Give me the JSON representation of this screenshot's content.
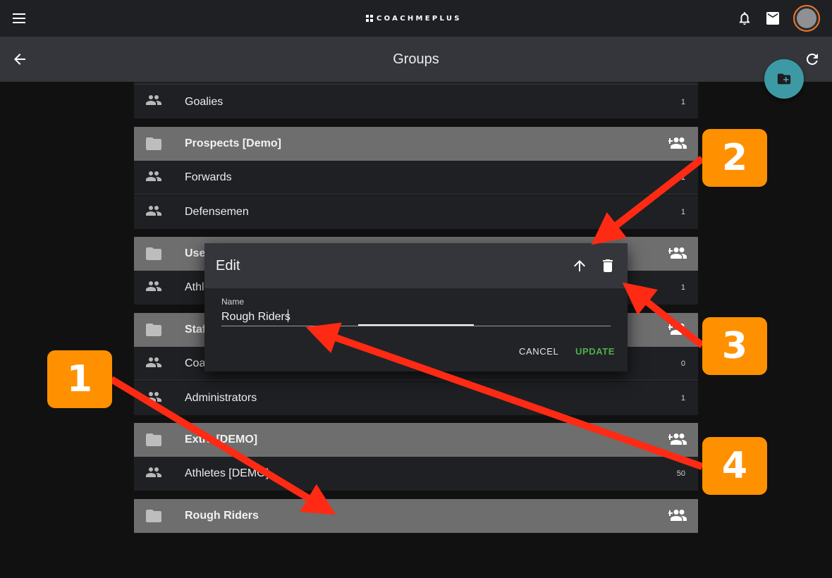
{
  "app": {
    "brand": "COACHMEPLUS",
    "page_title": "Groups"
  },
  "colors": {
    "fab": "#3d9aa5",
    "avatar_ring": "#f07a2b",
    "update_button": "#4caf50",
    "annotation_badge": "#ff9100",
    "annotation_arrow": "#ff2a14"
  },
  "icons": {
    "menu": "menu-icon",
    "notifications": "bell-icon",
    "messages": "mail-icon",
    "back": "arrow-back-icon",
    "refresh": "refresh-icon",
    "add_folder": "create-new-folder-icon",
    "folder": "folder-icon",
    "group": "group-icon",
    "add_group": "group-add-icon",
    "move_up": "arrow-up-icon",
    "delete": "trash-icon"
  },
  "groups": [
    {
      "type": "subgroup",
      "label": "Goalies",
      "count": "1"
    },
    {
      "type": "header",
      "label": "Prospects [Demo]"
    },
    {
      "type": "subgroup",
      "label": "Forwards",
      "count": "1"
    },
    {
      "type": "subgroup",
      "label": "Defensemen",
      "count": "1"
    },
    {
      "type": "header",
      "label": "Use"
    },
    {
      "type": "subgroup",
      "label": "Athl",
      "count": "1"
    },
    {
      "type": "header",
      "label": "Staf"
    },
    {
      "type": "subgroup",
      "label": "Coa",
      "count": "0"
    },
    {
      "type": "subgroup",
      "label": "Administrators",
      "count": "1"
    },
    {
      "type": "header",
      "label": "Extra [DEMO]"
    },
    {
      "type": "subgroup",
      "label": "Athletes [DEMO]",
      "count": "50"
    },
    {
      "type": "header",
      "label": "Rough Riders"
    }
  ],
  "dialog": {
    "title": "Edit",
    "field_label": "Name",
    "field_value": "Rough Riders",
    "cancel_label": "CANCEL",
    "update_label": "UPDATE"
  },
  "annotations": [
    {
      "number": "1"
    },
    {
      "number": "2"
    },
    {
      "number": "3"
    },
    {
      "number": "4"
    }
  ]
}
